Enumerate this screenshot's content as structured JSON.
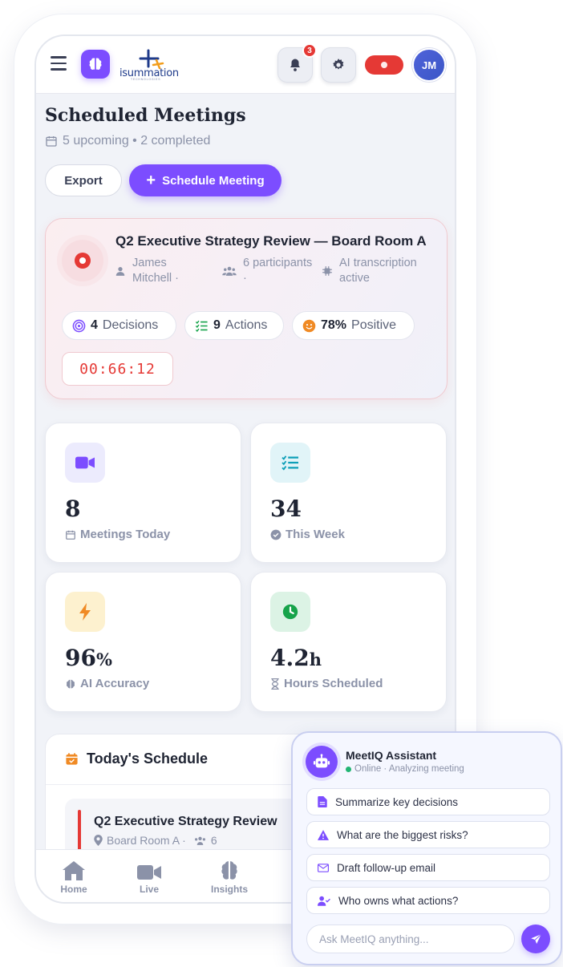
{
  "header": {
    "logo_text": "isummation",
    "logo_sub": "TECHNOLOGIES",
    "notification_count": "3",
    "avatar_initials": "JM",
    "colors": {
      "accent": "#7c4dff",
      "record": "#e53935",
      "avatar": "#4f63d9"
    }
  },
  "page": {
    "title": "Scheduled Meetings",
    "subtitle": "5 upcoming • 2 completed",
    "export_label": "Export",
    "schedule_label": "Schedule Meeting"
  },
  "live_meeting": {
    "title": "Q2 Executive Strategy Review — Board Room A",
    "host": "James Mitchell ·",
    "participants": "6 participants ·",
    "ai_status": "AI transcription active",
    "decisions_count": "4",
    "decisions_label": "Decisions",
    "actions_count": "9",
    "actions_label": "Actions",
    "sentiment_value": "78%",
    "sentiment_label": "Positive",
    "timer": "00:66:12"
  },
  "stats": [
    {
      "value": "8",
      "unit": "",
      "label": "Meetings Today",
      "icon": "video-icon"
    },
    {
      "value": "34",
      "unit": "",
      "label": "This Week",
      "icon": "checklist-icon"
    },
    {
      "value": "96",
      "unit": "%",
      "label": "AI Accuracy",
      "icon": "lightning-icon"
    },
    {
      "value": "4.2",
      "unit": "h",
      "label": "Hours Scheduled",
      "icon": "clock-icon"
    }
  ],
  "schedule": {
    "heading": "Today's Schedule",
    "items": [
      {
        "title": "Q2 Executive Strategy Review",
        "location": "Board Room A ·",
        "participants": "6"
      }
    ]
  },
  "nav": {
    "home": "Home",
    "live": "Live",
    "insights": "Insights"
  },
  "assistant": {
    "name": "MeetIQ Assistant",
    "status": "Online · Analyzing meeting",
    "quick_actions": [
      "Summarize key decisions",
      "What are the biggest risks?",
      "Draft follow-up email",
      "Who owns what actions?"
    ],
    "input_placeholder": "Ask MeetIQ anything..."
  }
}
